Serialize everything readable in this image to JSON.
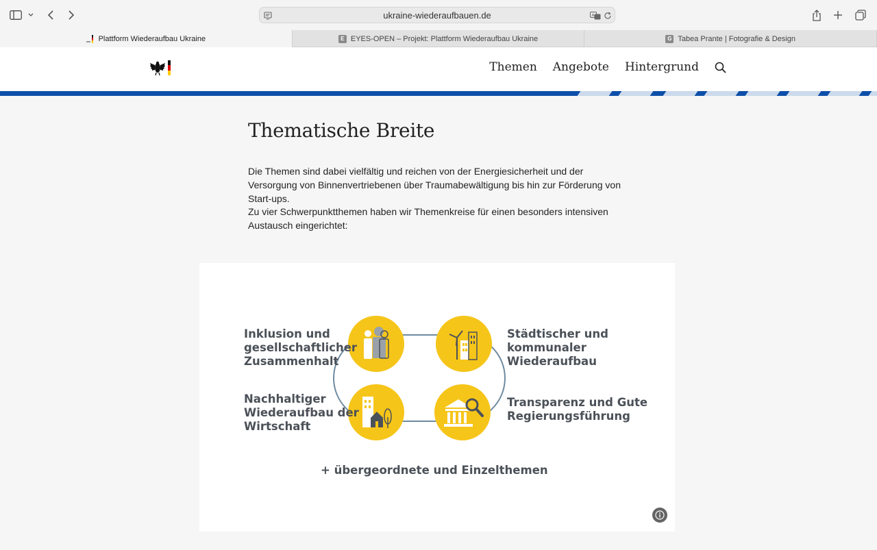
{
  "browser": {
    "url": "ukraine-wiederaufbauen.de",
    "tabs": [
      {
        "label": "Plattform Wiederaufbau Ukraine",
        "active": true
      },
      {
        "label": "EYES-OPEN – Projekt: Plattform Wiederaufbau Ukraine",
        "favicon_letter": "E",
        "active": false
      },
      {
        "label": "Tabea Prante  |  Fotografie & Design",
        "favicon_letter": "G",
        "active": false
      }
    ]
  },
  "site": {
    "nav": [
      "Themen",
      "Angebote",
      "Hintergrund"
    ],
    "accent_color": "#0d4fa8"
  },
  "content": {
    "title": "Thematische Breite",
    "paragraph1": "Die Themen sind dabei vielfältig und reichen von der Energiesicherheit und der Versorgung von Binnenvertriebenen über Traumabewältigung bis hin zur Förderung von Start-ups.",
    "paragraph2": "Zu vier Schwerpunktthemen haben wir Themenkreise für einen besonders intensiven Aus­tausch eingerichtet:"
  },
  "infographic": {
    "circle_color": "#f6c519",
    "topics": [
      {
        "lines": [
          "Inklusion und",
          "gesellschaftlicher",
          "Zusammenhalt"
        ],
        "icon": "people-icon"
      },
      {
        "lines": [
          "Städtischer und",
          "kommunaler",
          "Wiederaufbau"
        ],
        "icon": "windmill-buildings-icon"
      },
      {
        "lines": [
          "Nachhaltiger",
          "Wiederaufbau der",
          "Wirtschaft"
        ],
        "icon": "buildings-tree-icon"
      },
      {
        "lines": [
          "Transparenz und Gute",
          "Regierungsführung"
        ],
        "icon": "institution-magnifier-icon"
      }
    ],
    "footer": "+ übergeordnete und Einzelthemen"
  }
}
